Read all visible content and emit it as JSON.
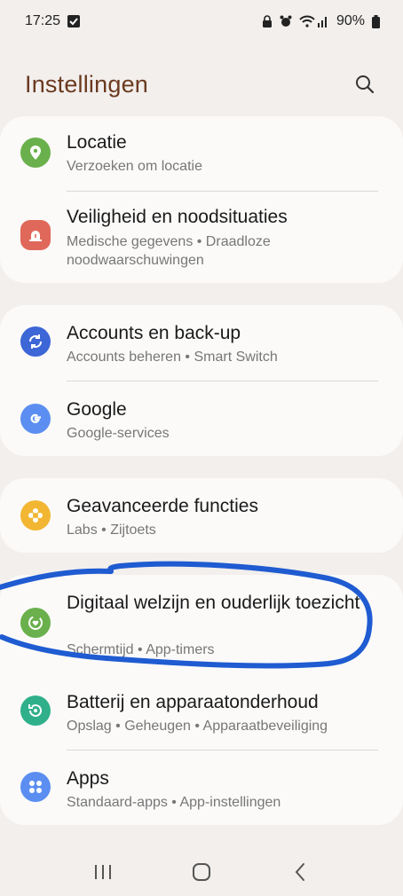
{
  "status": {
    "time": "17:25",
    "battery": "90%"
  },
  "header": {
    "title": "Instellingen"
  },
  "groups": [
    {
      "items": [
        {
          "label": "Locatie",
          "sub": "Verzoeken om locatie",
          "icon": "location-pin-icon",
          "color": "#6ab04c"
        },
        {
          "label": "Veiligheid en noodsituaties",
          "sub": "Medische gegevens  •  Draadloze noodwaarschuwingen",
          "icon": "emergency-icon",
          "color": "#e0685a"
        }
      ]
    },
    {
      "items": [
        {
          "label": "Accounts en back-up",
          "sub": "Accounts beheren  •  Smart Switch",
          "icon": "sync-icon",
          "color": "#3d66d6"
        },
        {
          "label": "Google",
          "sub": "Google-services",
          "icon": "google-icon",
          "color": "#5b8ef0"
        }
      ]
    },
    {
      "items": [
        {
          "label": "Geavanceerde functies",
          "sub": "Labs  •  Zijtoets",
          "icon": "gear-flower-icon",
          "color": "#f2b632"
        }
      ]
    },
    {
      "items": [
        {
          "label": "Digitaal welzijn en ouderlijk toezicht",
          "sub": "Schermtijd  •  App-timers",
          "icon": "wellbeing-icon",
          "color": "#6ab04c"
        },
        {
          "label": "Batterij en apparaatonderhoud",
          "sub": "Opslag  •  Geheugen  •  Apparaatbeveiliging",
          "icon": "device-care-icon",
          "color": "#2fb08a"
        },
        {
          "label": "Apps",
          "sub": "Standaard-apps  •  App-instellingen",
          "icon": "apps-icon",
          "color": "#5b8ef0"
        }
      ]
    }
  ],
  "annotation_color": "#1f5bd1"
}
